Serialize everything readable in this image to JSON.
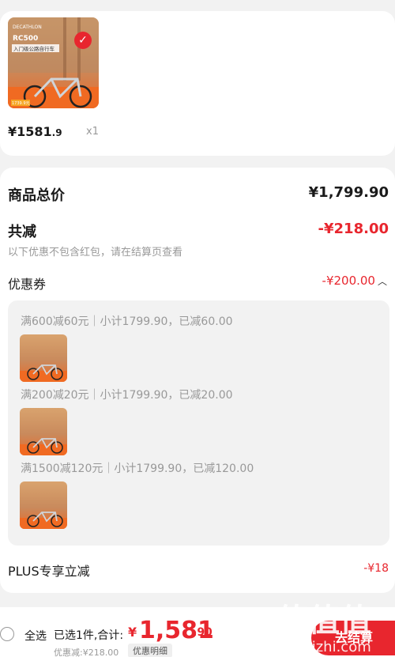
{
  "item": {
    "price_int": "¥1581",
    "price_dec": ".9",
    "qty": "x1",
    "thumb_brand": "DECATHLON",
    "thumb_model": "RC500",
    "thumb_sub": "入门级公路自行车",
    "thumb_price": "1739.9元"
  },
  "summary": {
    "total_label": "商品总价",
    "total_value": "¥1,799.90",
    "reduce_label": "共减",
    "reduce_value": "-¥218.00",
    "note": "以下优惠不包含红包，请在结算页查看"
  },
  "coupon": {
    "label": "优惠券",
    "value": "-¥200.00",
    "lines": [
      "满600减60元｜小计1799.90，已减60.00",
      "满200减20元｜小计1799.90，已减20.00",
      "满1500减120元｜小计1799.90，已减120.00"
    ]
  },
  "plus": {
    "label": "PLUS专享立减",
    "value": "-¥18"
  },
  "footer": {
    "select_all": "全选",
    "selected_text": "已选1件,合计:",
    "sum_currency": "¥",
    "sum_int": "1,581",
    "sum_dec": ".90",
    "discount_small": "优惠减:¥218.00",
    "detail_btn": "优惠明细",
    "checkout": "去结算"
  },
  "watermark": {
    "logo": "值值值",
    "site": "zhizhizhi.com"
  },
  "colors": {
    "accent": "#e8262e",
    "muted": "#999999",
    "background": "#f2f2f2"
  }
}
